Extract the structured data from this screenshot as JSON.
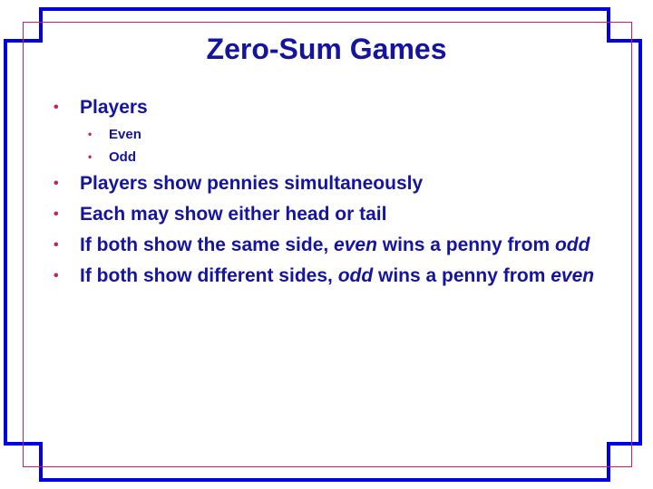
{
  "slide": {
    "title": "Zero-Sum Games",
    "bullet_glyph": "•",
    "players": {
      "label": "Players",
      "sub": [
        "Even",
        "Odd"
      ]
    },
    "b2": "Players show pennies simultaneously",
    "b3": "Each may show either head or tail",
    "b4": {
      "pre": "If both show the same side, ",
      "em1": "even",
      "mid": " wins a penny from ",
      "em2": "odd"
    },
    "b5": {
      "pre": "If both show different sides, ",
      "em1": "odd",
      "mid": " wins a penny from ",
      "em2": "even"
    }
  },
  "colors": {
    "frame_blue": "#0000e0",
    "frame_line": "#c8205a",
    "text": "#1414a0",
    "bullet": "#c8205a"
  }
}
